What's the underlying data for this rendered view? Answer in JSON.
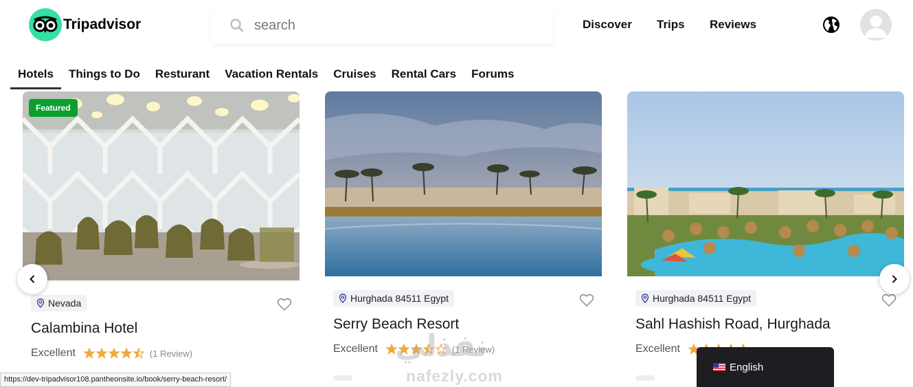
{
  "brand": {
    "name": "Tripadvisor"
  },
  "search": {
    "placeholder": "search"
  },
  "nav": {
    "discover": "Discover",
    "trips": "Trips",
    "reviews": "Reviews"
  },
  "tabs": [
    "Hotels",
    "Things to Do",
    "Resturant",
    "Vacation Rentals",
    "Cruises",
    "Rental Cars",
    "Forums"
  ],
  "cards": [
    {
      "badge": "Featured",
      "location": "Nevada",
      "title": "Calambina Hotel",
      "rating_label": "Excellent",
      "stars": 4.5,
      "reviews": "(1 Review)"
    },
    {
      "location": "Hurghada 84511 Egypt",
      "title": "Serry Beach Resort",
      "rating_label": "Excellent",
      "stars": 3.5,
      "reviews": "(1 Review)"
    },
    {
      "location": "Hurghada 84511 Egypt",
      "title": "Sahl Hashish Road, Hurghada",
      "rating_label": "Excellent",
      "stars": 5
    }
  ],
  "status_bar": "https://dev-tripadvisor108.pantheonsite.io/book/serry-beach-resort/",
  "language": {
    "label": "English"
  },
  "watermark": {
    "arabic": "نفذلي",
    "latin": "nafezly.com"
  },
  "colors": {
    "brand_green": "#34e0a1",
    "featured_green": "#0a9f2e",
    "star": "#f0a93b",
    "location_icon": "#3b3f9c"
  }
}
